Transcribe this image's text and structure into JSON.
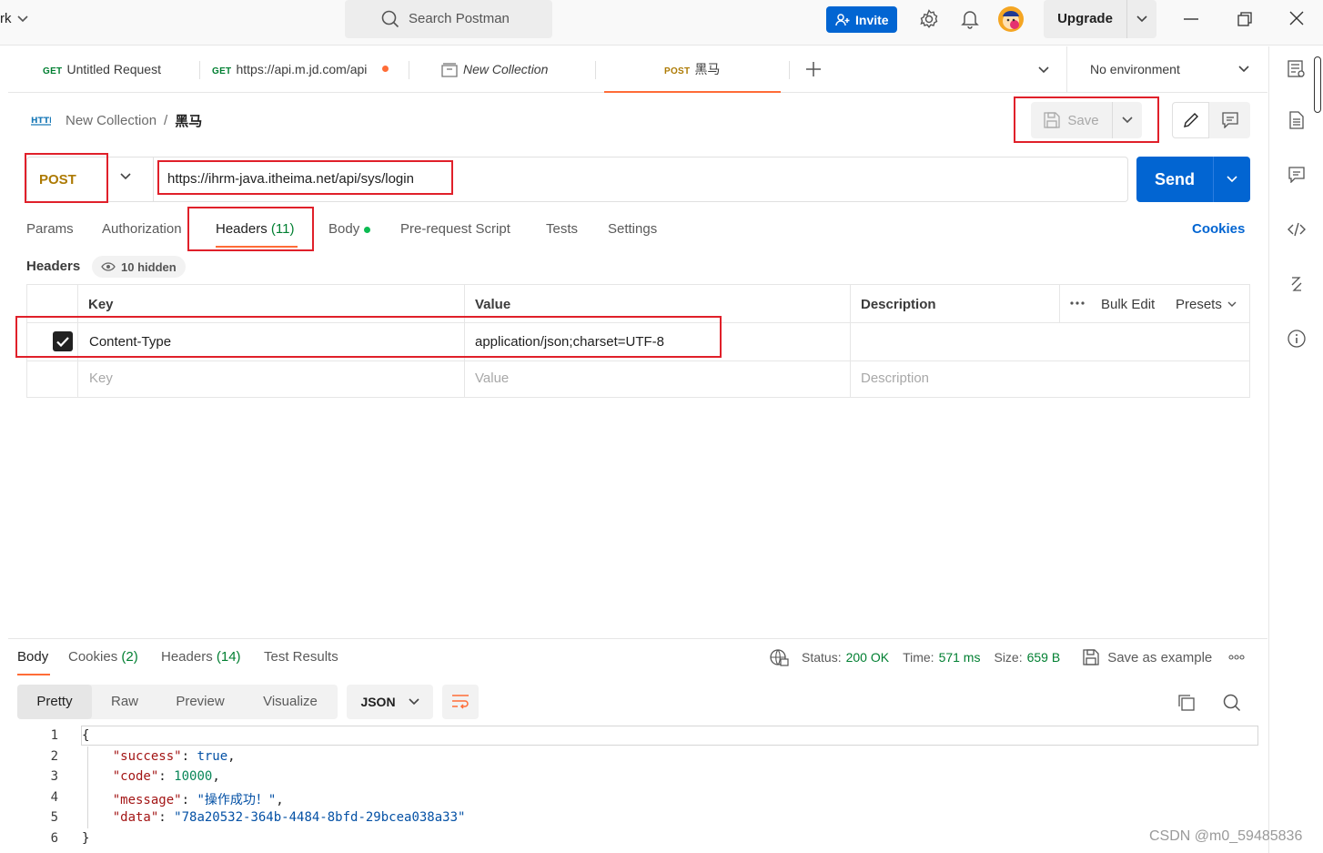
{
  "titlebar": {
    "workspace": "rk",
    "search_placeholder": "Search Postman",
    "invite_label": "Invite",
    "upgrade_label": "Upgrade"
  },
  "tabs": [
    {
      "method": "GET",
      "label": "Untitled Request"
    },
    {
      "method": "GET",
      "label": "https://api.m.jd.com/api"
    },
    {
      "method": "",
      "label": "New Collection"
    },
    {
      "method": "POST",
      "label": "黑马"
    }
  ],
  "environment": "No environment",
  "breadcrumb": {
    "collection": "New Collection",
    "separator": "/",
    "request": "黑马"
  },
  "save_label": "Save",
  "request": {
    "method": "POST",
    "url": "https://ihrm-java.itheima.net/api/sys/login",
    "send_label": "Send"
  },
  "request_tabs": {
    "params": "Params",
    "authorization": "Authorization",
    "headers": "Headers",
    "headers_count": "(11)",
    "body": "Body",
    "prerequest": "Pre-request Script",
    "tests": "Tests",
    "settings": "Settings",
    "cookies": "Cookies"
  },
  "headers_section": {
    "title": "Headers",
    "hidden": "10 hidden",
    "columns": {
      "key": "Key",
      "value": "Value",
      "description": "Description"
    },
    "bulk_edit": "Bulk Edit",
    "presets": "Presets",
    "rows": [
      {
        "checked": true,
        "key": "Content-Type",
        "value": "application/json;charset=UTF-8",
        "description": ""
      }
    ],
    "placeholders": {
      "key": "Key",
      "value": "Value",
      "description": "Description"
    }
  },
  "response": {
    "tabs": {
      "body": "Body",
      "cookies": "Cookies",
      "cookies_count": "(2)",
      "headers": "Headers",
      "headers_count": "(14)",
      "test_results": "Test Results"
    },
    "status_label": "Status:",
    "status_value": "200 OK",
    "time_label": "Time:",
    "time_value": "571 ms",
    "size_label": "Size:",
    "size_value": "659 B",
    "save_example": "Save as example",
    "views": {
      "pretty": "Pretty",
      "raw": "Raw",
      "preview": "Preview",
      "visualize": "Visualize"
    },
    "format": "JSON",
    "body_lines": [
      {
        "n": "1",
        "text": "{"
      },
      {
        "n": "2",
        "key": "\"success\"",
        "val": "true",
        "type": "bool"
      },
      {
        "n": "3",
        "key": "\"code\"",
        "val": "10000",
        "type": "num"
      },
      {
        "n": "4",
        "key": "\"message\"",
        "val": "\"操作成功！\"",
        "type": "str"
      },
      {
        "n": "5",
        "key": "\"data\"",
        "val": "\"78a20532-364b-4484-8bfd-29bcea038a33\"",
        "type": "str"
      },
      {
        "n": "6",
        "text": "}"
      }
    ]
  },
  "watermark": "CSDN @m0_59485836",
  "colors": {
    "accent": "#ff6c37",
    "primary": "#0265d2",
    "post": "#ad7a03",
    "get": "#007f31",
    "highlight": "#e0202a"
  }
}
